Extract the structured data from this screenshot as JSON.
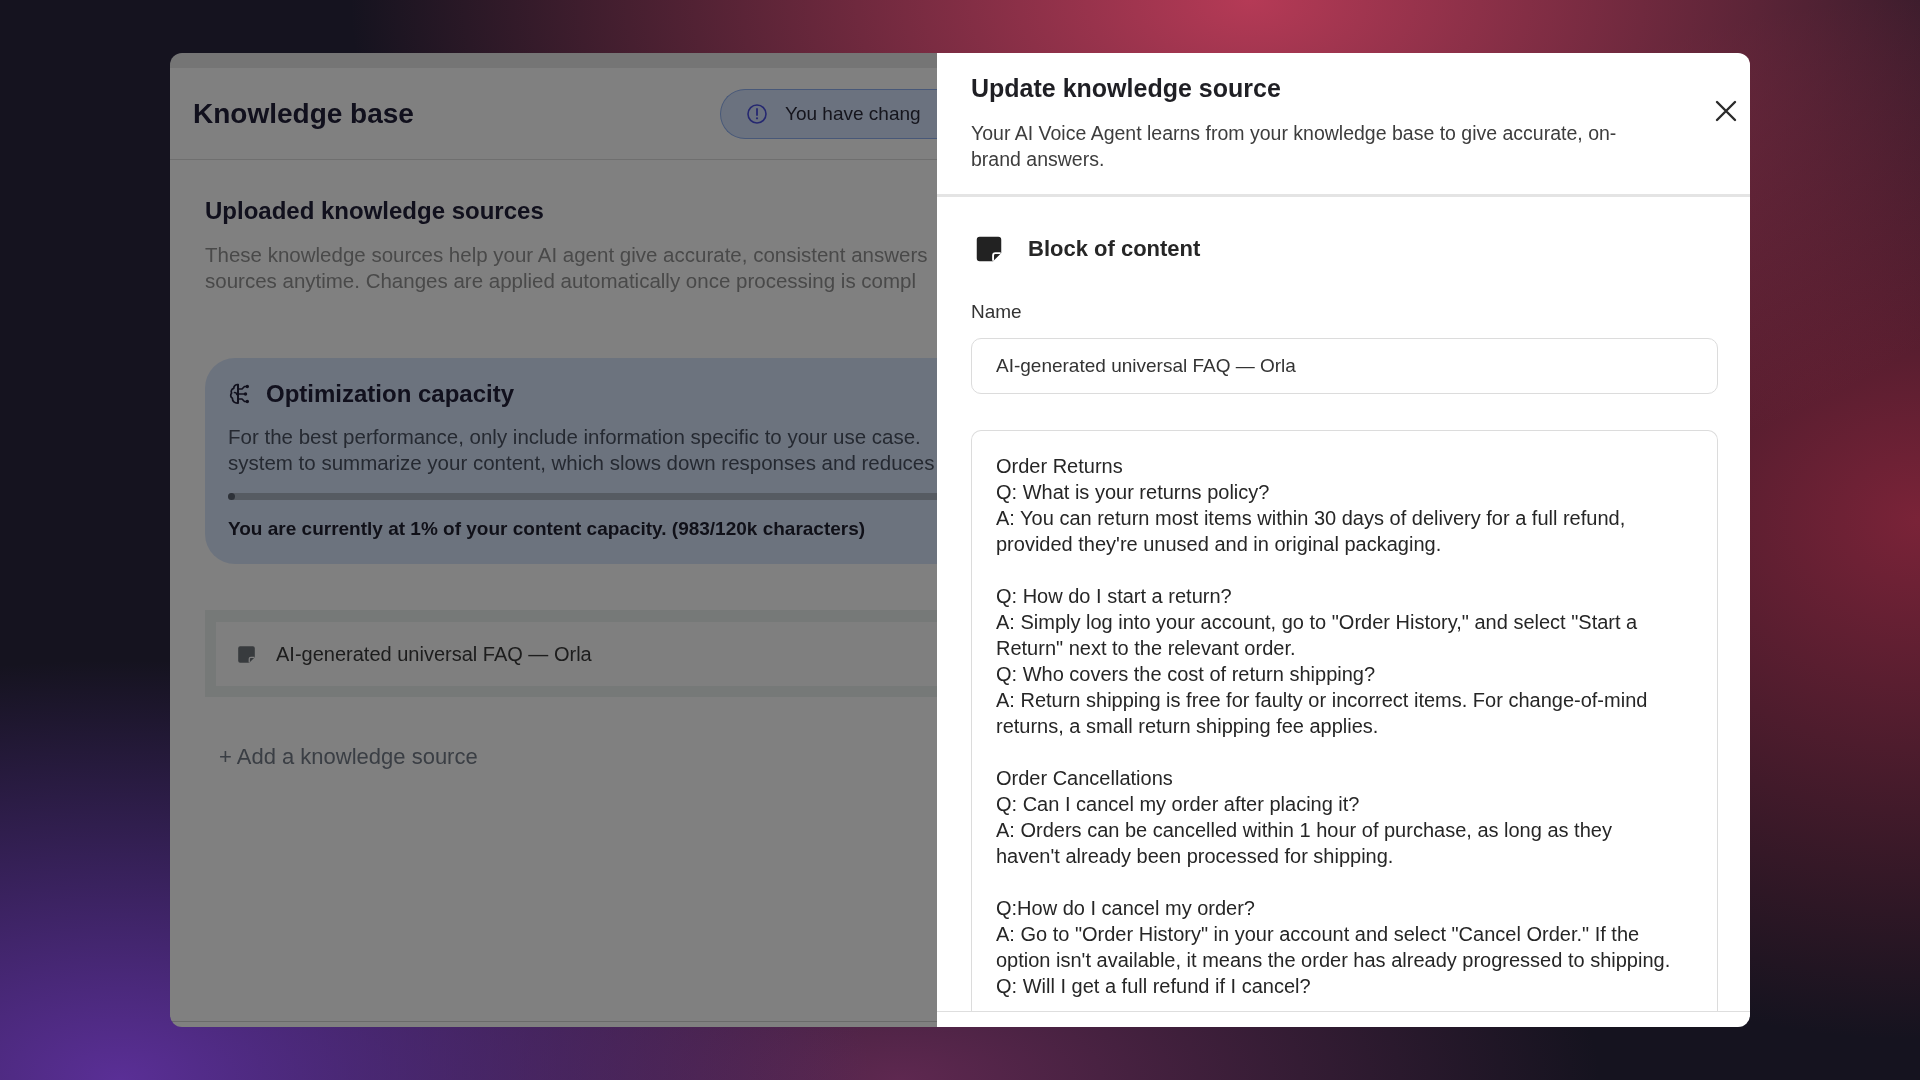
{
  "knowledge_base": {
    "dimmed": true,
    "title": "Knowledge base",
    "notice": {
      "text": "You have chang"
    },
    "section_title": "Uploaded knowledge sources",
    "description_lines": [
      "These knowledge sources help your AI agent give accurate, consistent answers",
      "sources anytime. Changes are applied automatically once processing is compl"
    ],
    "capacity": {
      "title": "Optimization capacity",
      "description_lines": [
        "For the best performance, only include information specific to your use case.",
        "system to summarize your content, which slows down responses and reduces"
      ],
      "level": 0.01,
      "status": "You are currently at 1% of your content capacity. (983/120k characters)"
    },
    "sources": [
      {
        "name": "AI-generated universal FAQ — Orla"
      }
    ],
    "add_source": "+ Add a knowledge source"
  },
  "panel": {
    "title": "Update knowledge source",
    "description": "Your AI Voice Agent learns from your knowledge base to give accurate, on-brand answers.",
    "source_type": "Block of content",
    "name_field": {
      "label": "Name",
      "value": "AI-generated universal FAQ — Orla"
    },
    "content_field": {
      "value": "Order Returns\nQ: What is your returns policy?\nA: You can return most items within 30 days of delivery for a full refund,\nprovided they're unused and in original packaging.\n\nQ: How do I start a return?\nA: Simply log into your account, go to \"Order History,\" and select \"Start a\nReturn\" next to the relevant order.\nQ: Who covers the cost of return shipping?\nA: Return shipping is free for faulty or incorrect items. For change-of-mind\nreturns, a small return shipping fee applies.\n\nOrder Cancellations\nQ: Can I cancel my order after placing it?\nA: Orders can be cancelled within 1 hour of purchase, as long as they\nhaven't already been processed for shipping.\n\nQ:How do I cancel my order?\nA: Go to \"Order History\" in your account and select \"Cancel Order.\" If the\noption isn't available, it means the order has already progressed to shipping.\nQ: Will I get a full refund if I cancel?"
    }
  }
}
